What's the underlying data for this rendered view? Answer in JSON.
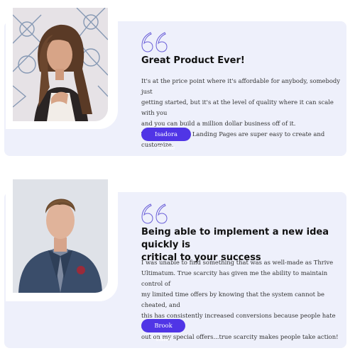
{
  "testimonials": [
    {
      "title": "Great Product Ever!",
      "body": "It's at the price point where it's affordable for anybody, somebody just\ngetting started, but it's at the level of quality where it can scale with you\nand you can build a million dollar business off of it.\nThrive Architect Landing Pages are super easy to create and customize.",
      "name": "Isadora Stone",
      "photo_icon": "woman-portrait-photo"
    },
    {
      "title": "Being able to implement a new idea quickly is\ncritical to your success",
      "body": " I was unable to find something that was as well-made as Thrive\nUltimatum. True scarcity has given me the ability to maintain control of\nmy limited time offers by knowing that the system cannot be cheated, and\nthis has consistently increased conversions because people hate missing\nout on my special offers...true scarcity makes people take action!",
      "name": "Brook Lane",
      "photo_icon": "man-portrait-photo"
    }
  ],
  "colors": {
    "card_bg": "#eef0fb",
    "button_bg": "#5035e6",
    "quote_stroke": "#6a5fd8"
  }
}
